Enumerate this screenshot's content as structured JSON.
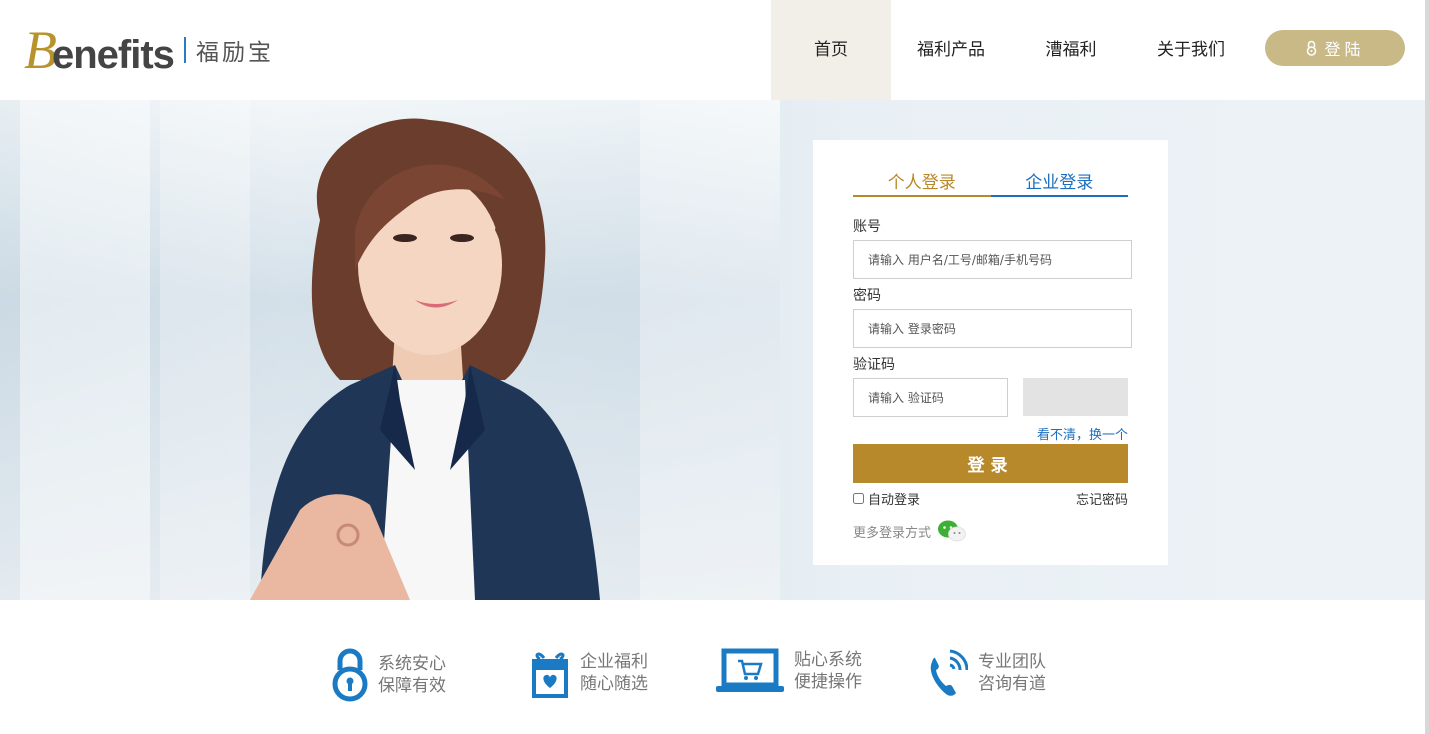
{
  "header": {
    "logo_text": "enefits",
    "logo_initial": "B",
    "logo_cn": "福励宝",
    "nav": [
      {
        "label": "首页",
        "active": true
      },
      {
        "label": "福利产品",
        "active": false
      },
      {
        "label": "漕福利",
        "active": false
      },
      {
        "label": "关于我们",
        "active": false
      }
    ],
    "login_button": "登陆"
  },
  "login": {
    "tabs": {
      "personal": "个人登录",
      "company": "企业登录"
    },
    "account_label": "账号",
    "account_placeholder": "请输入 用户名/工号/邮箱/手机号码",
    "password_label": "密码",
    "password_placeholder": "请输入 登录密码",
    "captcha_label": "验证码",
    "captcha_placeholder": "请输入 验证码",
    "captcha_refresh": "看不清，换一个",
    "submit": "登录",
    "auto_login": "自动登录",
    "forgot": "忘记密码",
    "more": "更多登录方式"
  },
  "features": [
    {
      "icon": "lock-icon",
      "line1": "系统安心",
      "line2": "保障有效"
    },
    {
      "icon": "gift-icon",
      "line1": "企业福利",
      "line2": "随心随选"
    },
    {
      "icon": "laptop-cart-icon",
      "line1": "贴心系统",
      "line2": "便捷操作"
    },
    {
      "icon": "phone-icon",
      "line1": "专业团队",
      "line2": "咨询有道"
    }
  ],
  "colors": {
    "gold": "#b8892a",
    "blue": "#1c6fbf",
    "login_button": "#c9b987",
    "feature_icon": "#1a7bc4"
  }
}
